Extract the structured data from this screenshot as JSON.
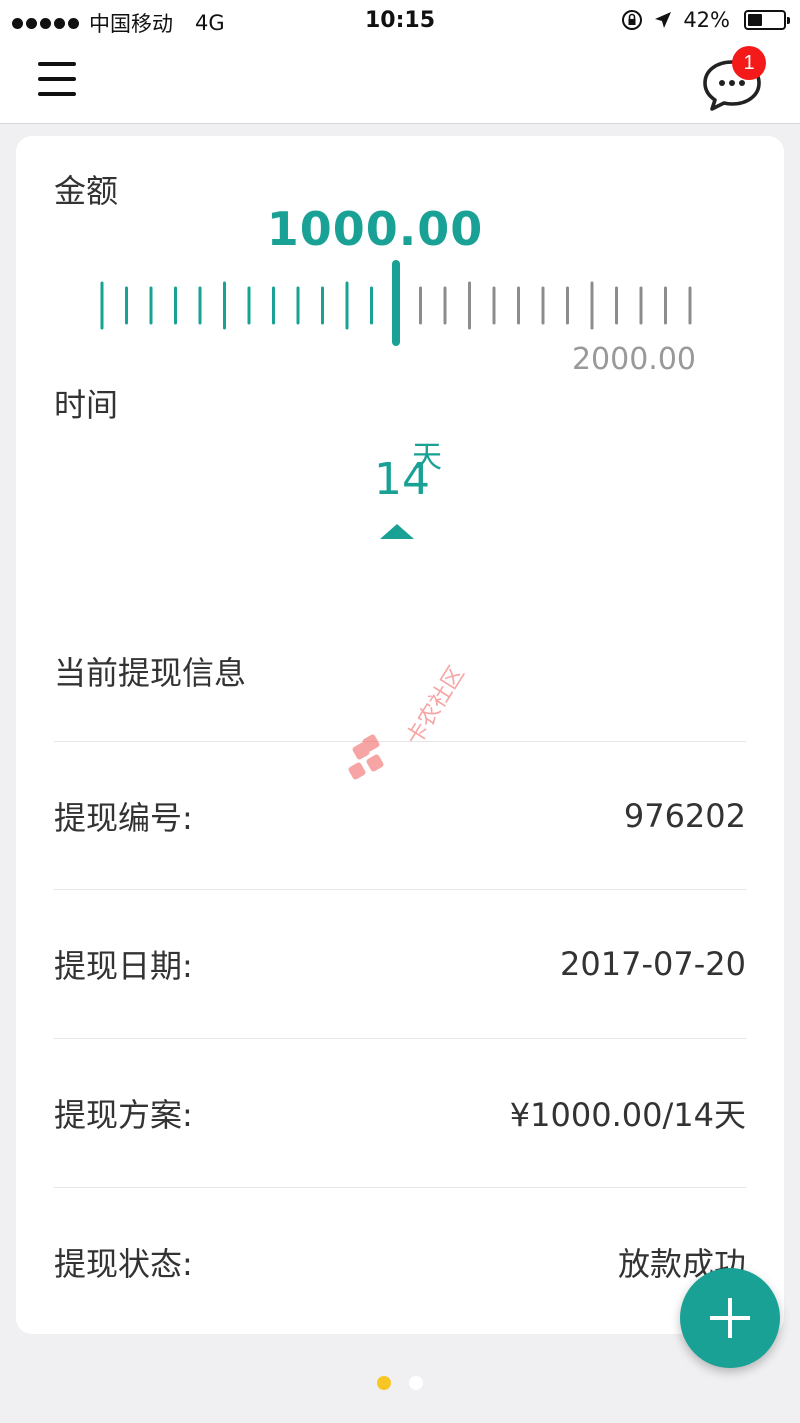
{
  "status_bar": {
    "carrier": "中国移动",
    "network": "4G",
    "time": "10:15",
    "battery_percent": "42%",
    "battery_level": 0.42
  },
  "nav": {
    "menu_icon": "hamburger-menu-icon",
    "message_icon": "chat-bubble-icon",
    "badge_count": "1"
  },
  "loan": {
    "amount_label": "金额",
    "amount_value": "1000.00",
    "amount_max": "2000.00",
    "amount_fraction": 0.5,
    "time_label": "时间",
    "days_value": "14",
    "days_unit": "天"
  },
  "info": {
    "title": "当前提现信息",
    "rows": [
      {
        "label": "提现编号:",
        "value": "976202"
      },
      {
        "label": "提现日期:",
        "value": "2017-07-20"
      },
      {
        "label": "提现方案:",
        "value": "¥1000.00/14天"
      },
      {
        "label": "提现状态:",
        "value": "放款成功"
      }
    ]
  },
  "watermark": {
    "text": "卡农社区"
  },
  "fab": {
    "icon": "plus-icon"
  },
  "pager": {
    "count": 2,
    "active_index": 0
  },
  "colors": {
    "accent": "#1aa196",
    "badge": "#f41a1a",
    "pager_active": "#f6c624",
    "pager_inactive": "#ffffff",
    "ruler_inactive": "#8c8c8c"
  }
}
